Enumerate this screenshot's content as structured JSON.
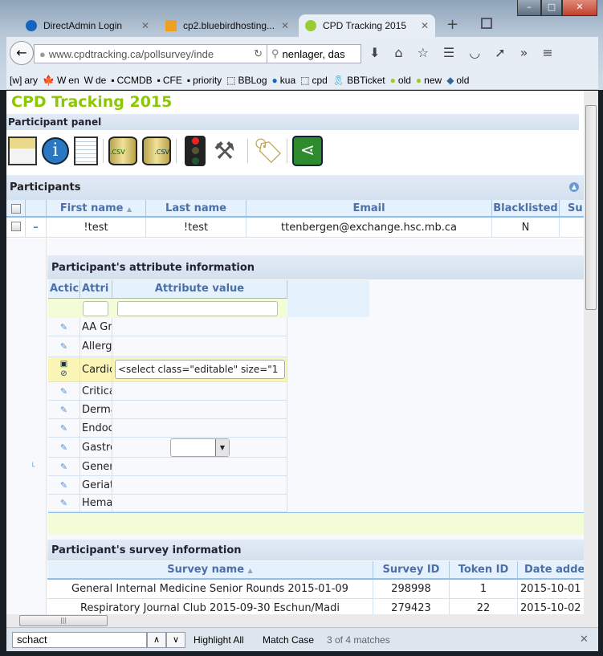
{
  "browser": {
    "tabs": [
      {
        "label": "DirectAdmin Login"
      },
      {
        "label": "cp2.bluebirdhosting..."
      },
      {
        "label": "CPD Tracking 2015"
      }
    ],
    "url": "www.cpdtracking.ca/pollsurvey/inde",
    "search": "nenlager, das",
    "bookmarks": [
      "ary",
      "en",
      "de",
      "CCMDB",
      "CFE",
      "priority",
      "BBLog",
      "kua",
      "cpd",
      "BBTicket",
      "old",
      "new",
      "old"
    ],
    "find": {
      "value": "schact",
      "highlight_all": "Highlight All",
      "match_case": "Match Case",
      "status": "3 of 4 matches"
    }
  },
  "page": {
    "title": "CPD Tracking 2015",
    "panel_title": "Participant panel",
    "toolbar_icons": [
      "home-icon",
      "info-icon",
      "document-icon",
      "import-csv-icon",
      "export-csv-icon",
      "traffic-light-icon",
      "tools-icon",
      "tag-icon",
      "share-icon"
    ],
    "participants": {
      "title": "Participants",
      "columns": [
        "First name",
        "Last name",
        "Email",
        "Blacklisted",
        "Su"
      ],
      "rows": [
        {
          "first": "!test",
          "last": "!test",
          "email": "ttenbergen@exchange.hsc.mb.ca",
          "blacklisted": "N"
        }
      ]
    },
    "attributes": {
      "title": "Participant's attribute information",
      "columns": [
        "Actic",
        "Attri",
        "Attribute value"
      ],
      "rows": [
        "AA Gr",
        "Allerg",
        "Cardic",
        "Critica",
        "Derma",
        "Endoc",
        "Gastro",
        "Gener",
        "Geriat",
        "Hema"
      ],
      "editing_value": "<select class=\"editable\" size=\"1"
    },
    "surveys": {
      "title": "Participant's survey information",
      "columns": [
        "Survey name",
        "Survey ID",
        "Token ID",
        "Date adde"
      ],
      "rows": [
        {
          "name": "General Internal Medicine Senior Rounds 2015-01-09",
          "id": "298998",
          "token": "1",
          "date": "2015-10-01"
        },
        {
          "name": "Respiratory Journal Club 2015-09-30 Eschun/Madi",
          "id": "279423",
          "token": "22",
          "date": "2015-10-02"
        }
      ]
    }
  }
}
